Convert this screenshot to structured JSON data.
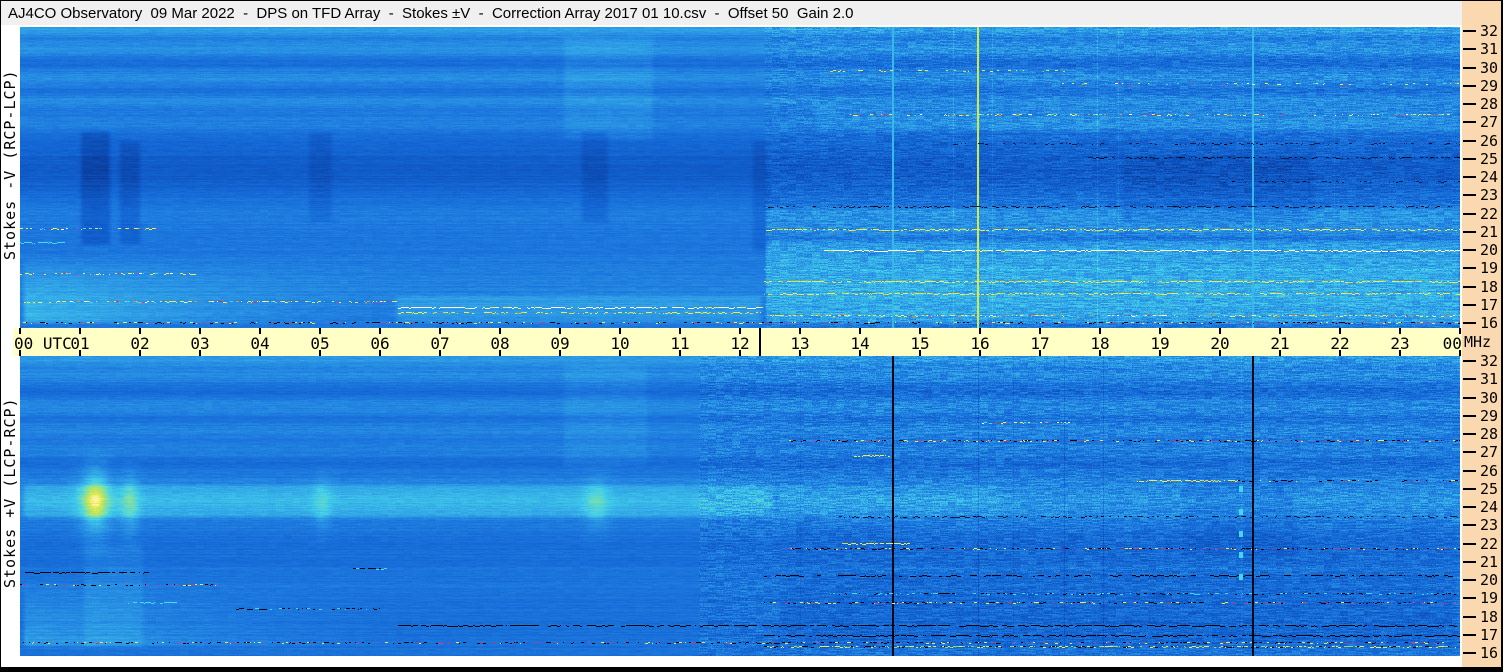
{
  "window": {
    "title": "AJ4CO Observatory  09 Mar 2022  -  DPS on TFD Array  -  Stokes ±V  -  Correction Array 2017 01 10.csv  -  Offset 50  Gain 2.0"
  },
  "colors": {
    "title_bar_bg": "#f0f0f0",
    "time_axis_bg": "#ffffc6",
    "right_margin_bg": "#fbd9b0",
    "border": "#000000"
  },
  "left_labels": {
    "top": "Stokes -V (RCP-LCP)",
    "bottom": "Stokes +V (LCP-RCP)"
  },
  "time_axis": {
    "unit_suffix": "MHz",
    "marker_hour": 12.33,
    "labels": [
      {
        "text": "00 UTC",
        "hour": 0
      },
      {
        "text": "01",
        "hour": 1
      },
      {
        "text": "02",
        "hour": 2
      },
      {
        "text": "03",
        "hour": 3
      },
      {
        "text": "04",
        "hour": 4
      },
      {
        "text": "05",
        "hour": 5
      },
      {
        "text": "06",
        "hour": 6
      },
      {
        "text": "07",
        "hour": 7
      },
      {
        "text": "08",
        "hour": 8
      },
      {
        "text": "09",
        "hour": 9
      },
      {
        "text": "10",
        "hour": 10
      },
      {
        "text": "11",
        "hour": 11
      },
      {
        "text": "12",
        "hour": 12
      },
      {
        "text": "13",
        "hour": 13
      },
      {
        "text": "14",
        "hour": 14
      },
      {
        "text": "15",
        "hour": 15
      },
      {
        "text": "16",
        "hour": 16
      },
      {
        "text": "17",
        "hour": 17
      },
      {
        "text": "18",
        "hour": 18
      },
      {
        "text": "19",
        "hour": 19
      },
      {
        "text": "20",
        "hour": 20
      },
      {
        "text": "21",
        "hour": 21
      },
      {
        "text": "22",
        "hour": 22
      },
      {
        "text": "23",
        "hour": 23
      },
      {
        "text": "00",
        "hour": 24
      }
    ]
  },
  "freq_axis": {
    "unit": "MHz",
    "ticks": [
      32,
      31,
      30,
      29,
      28,
      27,
      26,
      25,
      24,
      23,
      22,
      21,
      20,
      19,
      18,
      17,
      16
    ]
  },
  "chart_data": {
    "type": "heatmap",
    "title": "AJ4CO Observatory 09 Mar 2022 - DPS on TFD Array - Stokes ±V",
    "xlabel": "UTC",
    "ylabel": "MHz",
    "x_range_hours": [
      0,
      24
    ],
    "x_tick_interval_hours": 1,
    "y_range_mhz": [
      16,
      32
    ],
    "notable_features": {
      "vertical_interference_utc": [
        "14:33 (cyan/black full-band line)",
        "15:58 (yellow-green/dark full-band line)",
        "20:33 (cyan/black full-band line)"
      ],
      "emission_patches_utc": [
        "01:05-01:35 near 24 MHz (strong in Stokes +V, dark in -V)",
        "01:40-02:00",
        "04:50-05:10",
        "09:20-09:50"
      ],
      "broad_band": "light band at 23.5-25.5 MHz across 00-12.6 UTC (bright in +V, dark in -V)",
      "rfi_onset_utc": "dense speckled RFI after ~12:20 UTC in both panels",
      "strong_rfi_lines_mhz": [
        16.2,
        16.8,
        17.0,
        17.4,
        17.8,
        18.4,
        20.2,
        21.3,
        22.5,
        25.3,
        27.6
      ]
    },
    "colormap": [
      [
        0.0,
        "#000005"
      ],
      [
        0.1,
        "#082f86"
      ],
      [
        0.22,
        "#0c4cb4"
      ],
      [
        0.34,
        "#1263d2"
      ],
      [
        0.44,
        "#1d79de"
      ],
      [
        0.56,
        "#2f9fe6"
      ],
      [
        0.68,
        "#41cdea"
      ],
      [
        0.78,
        "#79dfae"
      ],
      [
        0.86,
        "#b5e465"
      ],
      [
        0.93,
        "#f2ea50"
      ],
      [
        1.0,
        "#ffffff"
      ]
    ],
    "panels": [
      {
        "name": "Stokes -V (RCP-LCP)",
        "seed": 12345,
        "base": 0.42,
        "row_bands": [
          {
            "f": 32.2,
            "s": 0.22,
            "a": 0.14
          },
          {
            "f": 31.2,
            "s": 0.38,
            "a": 0.09
          },
          {
            "f": 30.4,
            "s": 0.25,
            "a": -0.045
          },
          {
            "f": 29.6,
            "s": 0.35,
            "a": 0.085
          },
          {
            "f": 28.9,
            "s": 0.2,
            "a": -0.03
          },
          {
            "f": 28.3,
            "s": 0.3,
            "a": 0.07
          },
          {
            "f": 27.1,
            "s": 0.35,
            "a": 0.05
          },
          {
            "f": 26.4,
            "s": 0.25,
            "a": -0.03
          },
          {
            "f": 24.6,
            "s": 1.0,
            "a": -0.12
          },
          {
            "f": 22.2,
            "s": 0.5,
            "a": 0.04
          },
          {
            "f": 18.0,
            "s": 1.2,
            "a": 0.05
          }
        ],
        "regions": [
          {
            "t0": 0.95,
            "t1": 1.55,
            "f0": 20.3,
            "f1": 26.8,
            "a": -0.12
          },
          {
            "t0": 1.6,
            "t1": 2.05,
            "f0": 20.3,
            "f1": 26.3,
            "a": -0.09
          },
          {
            "t0": 4.75,
            "t1": 5.25,
            "f0": 21.5,
            "f1": 26.8,
            "a": -0.06
          },
          {
            "t0": 9.3,
            "t1": 9.85,
            "f0": 21.5,
            "f1": 26.8,
            "a": -0.07
          },
          {
            "t0": 12.15,
            "t1": 12.5,
            "f0": 20.0,
            "f1": 26.3,
            "a": -0.07
          },
          {
            "t0": 0,
            "t1": 6.2,
            "f0": 16,
            "f1": 19.8,
            "a": 0.2,
            "fade": "lt"
          },
          {
            "t0": 12.4,
            "t1": 24,
            "f0": 16,
            "f1": 20.8,
            "a": 0.13,
            "et": 0.05
          },
          {
            "t0": 12.4,
            "t1": 24,
            "f0": 20.8,
            "f1": 22.6,
            "a": 0.07,
            "et": 0.05
          },
          {
            "t0": 13.2,
            "t1": 24,
            "f0": 26.5,
            "f1": 28.2,
            "a": 0.05
          },
          {
            "t0": 18.3,
            "t1": 21.6,
            "f0": 21.5,
            "f1": 25.5,
            "a": -0.05
          },
          {
            "t0": 9.0,
            "t1": 10.6,
            "f0": 26,
            "f1": 32,
            "a": 0.05
          },
          {
            "t0": 6.2,
            "t1": 12.4,
            "f0": 16,
            "f1": 17.8,
            "a": 0.09
          }
        ],
        "noise": {
          "base": 0.03,
          "rfi_t0": 12.4,
          "rfi_amp": 0.09
        },
        "hlines": [
          {
            "f": 21.35,
            "t0": 0,
            "t1": 2.3,
            "d": 0.5,
            "c": "mix"
          },
          {
            "f": 20.55,
            "t0": 0,
            "t1": 0.75,
            "d": 0.8,
            "c": "cyan"
          },
          {
            "f": 18.85,
            "t0": 0,
            "t1": 3.1,
            "d": 0.5,
            "c": "mix"
          },
          {
            "f": 17.35,
            "t0": 0,
            "t1": 6.3,
            "d": 0.55,
            "c": "mix"
          },
          {
            "f": 17.0,
            "t0": 6.3,
            "t1": 12.35,
            "d": 0.9,
            "c": "white"
          },
          {
            "f": 16.75,
            "t0": 6.3,
            "t1": 12.35,
            "d": 0.6,
            "c": "yellow"
          },
          {
            "f": 16.2,
            "t0": 0,
            "t1": 24,
            "d": 0.45,
            "c": "darkmix"
          },
          {
            "f": 21.3,
            "t0": 12.4,
            "t1": 24,
            "d": 0.75,
            "c": "yellow"
          },
          {
            "f": 20.15,
            "t0": 13.4,
            "t1": 24,
            "d": 0.95,
            "c": "white"
          },
          {
            "f": 18.45,
            "t0": 12.4,
            "t1": 24,
            "d": 0.8,
            "c": "yellow"
          },
          {
            "f": 17.75,
            "t0": 12.4,
            "t1": 24,
            "d": 0.7,
            "c": "yellow"
          },
          {
            "f": 19.1,
            "t0": 12.4,
            "t1": 24,
            "d": 0.5,
            "c": "cyan"
          },
          {
            "f": 22.55,
            "t0": 12.4,
            "t1": 24,
            "d": 0.55,
            "c": "dark"
          },
          {
            "f": 25.2,
            "t0": 17.8,
            "t1": 24,
            "d": 0.6,
            "c": "dark"
          },
          {
            "f": 27.6,
            "t0": 13.8,
            "t1": 24,
            "d": 0.35,
            "c": "mix"
          },
          {
            "f": 30.0,
            "t0": 13.5,
            "t1": 17.5,
            "d": 0.25,
            "c": "yellow"
          },
          {
            "f": 29.3,
            "t0": 17.0,
            "t1": 24,
            "d": 0.2,
            "c": "mix"
          },
          {
            "f": 26.0,
            "t0": 15.5,
            "t1": 24,
            "d": 0.3,
            "c": "dark"
          },
          {
            "f": 16.55,
            "t0": 12.4,
            "t1": 24,
            "d": 0.6,
            "c": "mix"
          },
          {
            "f": 23.9,
            "t0": 20.0,
            "t1": 24,
            "d": 0.3,
            "c": "dark"
          }
        ],
        "vlines": [
          {
            "t": 14.55,
            "w": 2,
            "c": "#35b9e8"
          },
          {
            "t": 15.55,
            "w": 1,
            "dv": 0.07
          },
          {
            "t": 15.97,
            "w": 2,
            "c": "#cfe952"
          },
          {
            "t": 16.2,
            "w": 1,
            "dv": 0.06
          },
          {
            "t": 17.95,
            "w": 1,
            "dv": 0.08
          },
          {
            "t": 18.3,
            "w": 1,
            "dv": 0.05
          },
          {
            "t": 20.55,
            "w": 2,
            "c": "#35b9e8"
          },
          {
            "t": 21.9,
            "w": 1,
            "dv": 0.04
          }
        ]
      },
      {
        "name": "Stokes +V (LCP-RCP)",
        "seed": 67890,
        "base": 0.42,
        "row_bands": [
          {
            "f": 32.1,
            "s": 0.22,
            "a": 0.12
          },
          {
            "f": 31.2,
            "s": 0.38,
            "a": 0.08
          },
          {
            "f": 30.4,
            "s": 0.3,
            "a": -0.05
          },
          {
            "f": 29.5,
            "s": 0.35,
            "a": 0.075
          },
          {
            "f": 28.8,
            "s": 0.2,
            "a": -0.03
          },
          {
            "f": 28.2,
            "s": 0.3,
            "a": 0.06
          },
          {
            "f": 27.1,
            "s": 0.35,
            "a": 0.045
          },
          {
            "f": 26.3,
            "s": 0.3,
            "a": -0.035
          },
          {
            "f": 24.3,
            "s": 0.8,
            "a": 0.1
          },
          {
            "f": 21.5,
            "s": 0.6,
            "a": -0.03
          },
          {
            "f": 17.5,
            "s": 1.0,
            "a": -0.02
          }
        ],
        "regions": [
          {
            "t0": 0.95,
            "t1": 1.55,
            "f0": 21.8,
            "f1": 26.6,
            "a": 0.22,
            "fade": "gauss"
          },
          {
            "t0": 1.05,
            "t1": 1.45,
            "f0": 23.0,
            "f1": 25.6,
            "a": 0.12,
            "fade": "gauss"
          },
          {
            "t0": 1.65,
            "t1": 2.0,
            "f0": 22.0,
            "f1": 26.0,
            "a": 0.16,
            "fade": "gauss"
          },
          {
            "t0": 4.85,
            "t1": 5.2,
            "f0": 22.3,
            "f1": 25.8,
            "a": 0.1,
            "fade": "gauss"
          },
          {
            "t0": 9.35,
            "t1": 9.85,
            "f0": 22.3,
            "f1": 25.8,
            "a": 0.12,
            "fade": "gauss"
          },
          {
            "t0": 0,
            "t1": 12.6,
            "f0": 23.2,
            "f1": 25.3,
            "a": 0.1
          },
          {
            "t0": 12.6,
            "t1": 16.4,
            "f0": 23.2,
            "f1": 25.3,
            "a": 0.04
          },
          {
            "t0": 0,
            "t1": 6.5,
            "f0": 16,
            "f1": 20.0,
            "a": 0.16,
            "fade": "lt"
          },
          {
            "t0": 1.0,
            "t1": 2.1,
            "f0": 16,
            "f1": 22,
            "a": 0.05
          },
          {
            "t0": 12.6,
            "t1": 24,
            "f0": 16,
            "f1": 20.5,
            "a": -0.04
          },
          {
            "t0": 12.6,
            "t1": 24,
            "f0": 20.5,
            "f1": 23.0,
            "a": -0.02
          },
          {
            "t0": 19.3,
            "t1": 21.3,
            "f0": 21,
            "f1": 26,
            "a": -0.04
          },
          {
            "t0": 9.0,
            "t1": 10.5,
            "f0": 26,
            "f1": 32,
            "a": 0.04
          }
        ],
        "noise": {
          "base": 0.03,
          "rfi_t0": 11.3,
          "rfi_amp": 0.1
        },
        "hlines": [
          {
            "f": 20.3,
            "t0": 0,
            "t1": 2.1,
            "d": 0.7,
            "c": "black"
          },
          {
            "f": 19.6,
            "t0": 0,
            "t1": 3.3,
            "d": 0.5,
            "c": "darkmix"
          },
          {
            "f": 18.3,
            "t0": 3.6,
            "t1": 6.0,
            "d": 0.6,
            "c": "darkcyan"
          },
          {
            "f": 18.6,
            "t0": 1.8,
            "t1": 2.6,
            "d": 0.8,
            "c": "cyan"
          },
          {
            "f": 17.35,
            "t0": 6.3,
            "t1": 24,
            "d": 0.85,
            "c": "black"
          },
          {
            "f": 16.4,
            "t0": 0,
            "t1": 24,
            "d": 0.5,
            "c": "darkmix"
          },
          {
            "f": 27.6,
            "t0": 12.8,
            "t1": 24,
            "d": 0.55,
            "c": "darkmix"
          },
          {
            "f": 26.8,
            "t0": 13.9,
            "t1": 14.5,
            "d": 0.9,
            "c": "yellow"
          },
          {
            "f": 28.6,
            "t0": 16.0,
            "t1": 17.5,
            "d": 0.4,
            "c": "mix"
          },
          {
            "f": 25.4,
            "t0": 18.6,
            "t1": 20.3,
            "d": 0.85,
            "c": "yellow"
          },
          {
            "f": 25.4,
            "t0": 20.3,
            "t1": 24,
            "d": 0.4,
            "c": "darkmix"
          },
          {
            "f": 23.4,
            "t0": 13.6,
            "t1": 24,
            "d": 0.5,
            "c": "dark"
          },
          {
            "f": 21.6,
            "t0": 12.8,
            "t1": 24,
            "d": 0.55,
            "c": "darkmix"
          },
          {
            "f": 21.9,
            "t0": 13.7,
            "t1": 14.8,
            "d": 0.8,
            "c": "yellow"
          },
          {
            "f": 20.1,
            "t0": 12.4,
            "t1": 24,
            "d": 0.6,
            "c": "black"
          },
          {
            "f": 19.1,
            "t0": 13.5,
            "t1": 24,
            "d": 0.5,
            "c": "darkcyan"
          },
          {
            "f": 18.6,
            "t0": 12.4,
            "t1": 24,
            "d": 0.5,
            "c": "darkmix"
          },
          {
            "f": 16.8,
            "t0": 12.4,
            "t1": 24,
            "d": 0.8,
            "c": "black"
          },
          {
            "f": 16.15,
            "t0": 12.4,
            "t1": 24,
            "d": 0.7,
            "c": "mixbright"
          },
          {
            "f": 20.5,
            "t0": 5.5,
            "t1": 6.2,
            "d": 0.6,
            "c": "darkcyan"
          }
        ],
        "vlines": [
          {
            "t": 14.55,
            "w": 2,
            "c": "#000818"
          },
          {
            "t": 20.55,
            "w": 2,
            "c": "#000818"
          },
          {
            "t": 15.97,
            "w": 1,
            "dv": -0.1
          },
          {
            "t": 17.4,
            "w": 1,
            "dv": -0.08
          },
          {
            "t": 18.05,
            "w": 1,
            "dv": -0.08
          },
          {
            "t": 16.55,
            "w": 1,
            "dv": -0.05
          },
          {
            "t": 13.0,
            "w": 1,
            "dv": -0.04
          },
          {
            "t": 20.35,
            "w": 1,
            "dv": 0.05
          }
        ],
        "dots": {
          "t": 20.33,
          "fs": [
            24.9,
            23.6,
            22.4,
            21.2,
            20.0
          ],
          "c": "#3fd8f0"
        }
      }
    ]
  }
}
